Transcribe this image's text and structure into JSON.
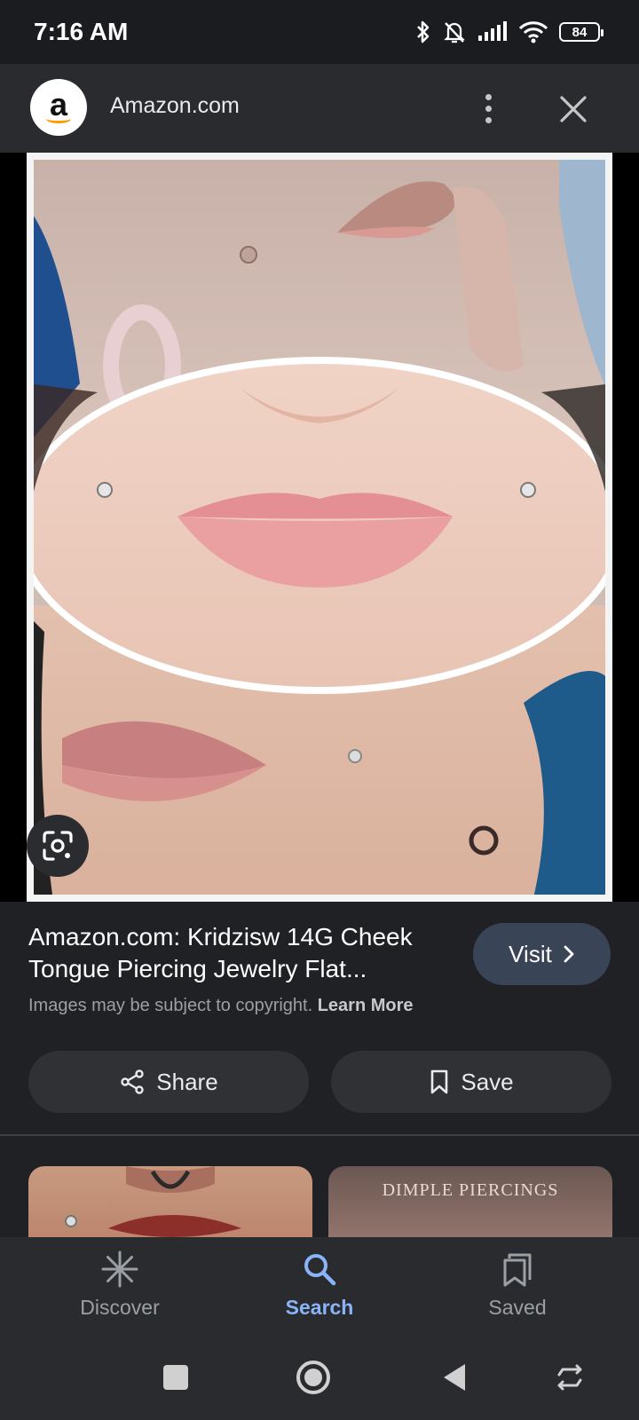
{
  "status_bar": {
    "time": "7:16 AM",
    "battery": "84",
    "icons": [
      "bluetooth-icon",
      "bell-muted-icon",
      "signal-icon",
      "wifi-icon",
      "battery-icon"
    ]
  },
  "header": {
    "favicon_letter": "a",
    "site": "Amazon.com",
    "icons": [
      "more-vert-icon",
      "close-icon"
    ]
  },
  "image": {
    "lens_icon": "google-lens-icon"
  },
  "result": {
    "title": "Amazon.com: Kridzisw 14G Cheek Tongue Piercing Jewelry Flat...",
    "visit_label": "Visit",
    "copyright": "Images may be subject to copyright.",
    "learn_more": "Learn More",
    "share_label": "Share",
    "save_label": "Save"
  },
  "related": {
    "thumb2_caption": "DIMPLE PIERCINGS"
  },
  "bottom_nav": {
    "items": [
      {
        "label": "Discover",
        "icon": "asterisk-icon"
      },
      {
        "label": "Search",
        "icon": "search-icon",
        "active": true
      },
      {
        "label": "Saved",
        "icon": "saved-collections-icon"
      }
    ]
  },
  "colors": {
    "accent": "#8ab4f8",
    "visit_button": "#394457",
    "background": "#202124"
  }
}
